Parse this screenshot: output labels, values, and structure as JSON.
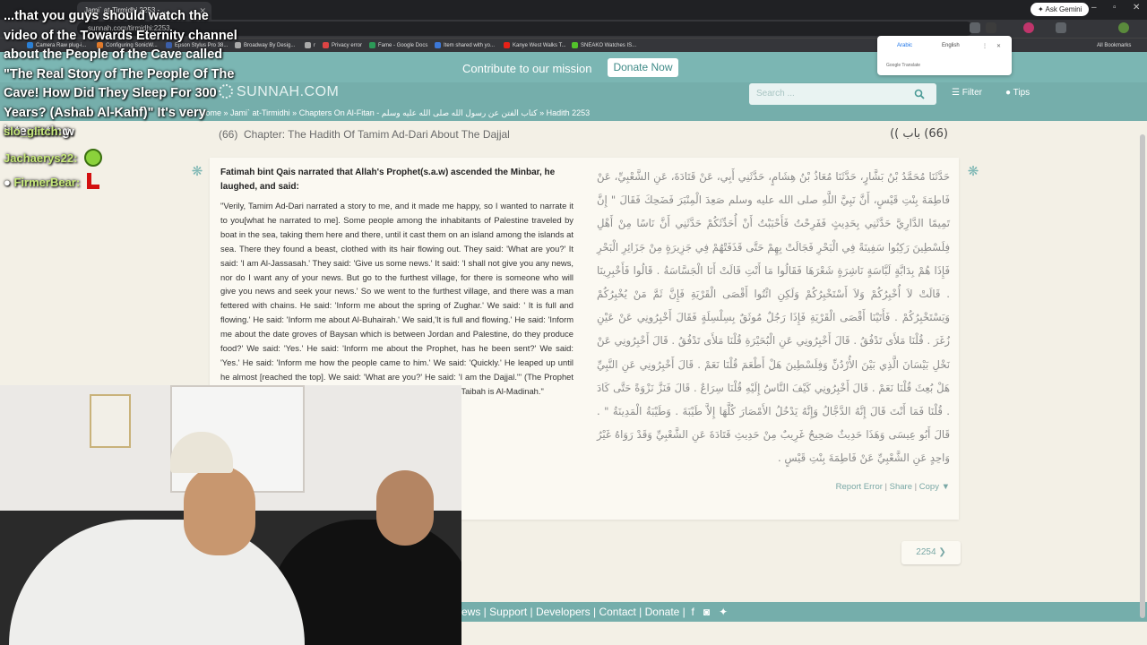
{
  "browser": {
    "tab_title": "Jami` at-Tirmidhi 2253 - ...",
    "omnibox_url": "sunnah.com/tirmidhi:2253",
    "ask_gemini": "✦ Ask Gemini",
    "bookmarks": [
      "Camera Raw plug-i...",
      "Configuring SonicW...",
      "Epson Stylus Pro 38...",
      "Broadway By Desig...",
      "r",
      "Privacy error",
      "Fame - Google Docs",
      "Item shared with yo...",
      "Kanye West Walks T...",
      "SNEAKO Watches IS..."
    ],
    "all_bookmarks": "All Bookmarks"
  },
  "translate_popup": {
    "lang_from": "Arabic",
    "lang_to": "English",
    "footer": "Google Translate"
  },
  "site": {
    "contribute_text": "Contribute to our mission",
    "donate_label": "Donate Now",
    "logo": "SUNNAH.COM",
    "search_placeholder": "Search ...",
    "filter_label": "Filter",
    "tips_label": "Tips",
    "breadcrumb": "Home » Jami` at-Tirmidhi » Chapters On Al-Fitan - كتاب الفتن عن رسول الله صلى الله عليه وسلم » Hadith 2253"
  },
  "chapter": {
    "number": "(66)",
    "title_en": "Chapter: The Hadith Of Tamim Ad-Dari About The Dajjal",
    "title_ar": "(66) باب ))"
  },
  "hadith": {
    "narrator": "Fatimah bint Qais narrated that Allah's Prophet(s.a.w) ascended the Minbar, he laughed, and said:",
    "english": "\"Verily, Tamim Ad-Dari narrated a story to me, and it made me happy, so I wanted to narrate it to you[what he narrated to me]. Some people among the inhabitants of Palestine traveled by boat in the sea, taking them here and there, until it cast them on an island among the islands at sea. There they found a beast, clothed with its hair flowing out. They said: 'What are you?' It said: 'I am Al-Jassasah.' They said: 'Give us some news.' It said: 'I shall not give you any news, nor do I want any of your news. But go to the furthest village, for there is someone who will give you news and seek your news.' So we went to the furthest village, and there was a man fettered with chains. He said: 'Inform me about the spring of Zughar.' We said: ' It is full and flowing.' He said: 'Inform me about Al-Buhairah.' We said,'It is full and flowing.' He said: 'Inform me about the date groves of Baysan which is between Jordan and Palestine, do they produce food?' We said: 'Yes.' He said: 'Inform me about the Prophet, has he been sent?' We said: 'Yes.' He said: 'Inform me how the people came to him.' We said: 'Quickly.' He leaped up until he almost [reached the top]. We said: 'What are you?' He said: 'I am the Dajjal.'\" (The Prophet (s.a.w) said:) \"He will enter all of the cities except Taibah, and At-Taibah is Al-Madinah.\"",
    "arabic": "حَدَّثَنَا مُحَمَّدُ بْنُ بَشَّارٍ، حَدَّثَنَا مُعَاذُ بْنُ هِشَامٍ، حَدَّثَنِي أَبِي، عَنْ قَتَادَةَ، عَنِ الشَّعْبِيِّ، عَنْ فَاطِمَةَ بِنْتِ قَيْسٍ، أَنَّ نَبِيَّ اللَّهِ صلى الله عليه وسلم صَعِدَ الْمِنْبَرَ فَضَحِكَ فَقَالَ ‏\"‏ إِنَّ تَمِيمًا الدَّارِيَّ حَدَّثَنِي بِحَدِيثٍ فَفَرِحْتُ فَأَحْبَبْتُ أَنْ أُحَدِّثَكُمْ حَدَّثَنِي أَنَّ نَاسًا مِنْ أَهْلِ فِلَسْطِينَ رَكِبُوا سَفِينَةً فِي الْبَحْرِ فَجَالَتْ بِهِمْ حَتَّى قَذَفَتْهُمْ فِي جَزِيرَةٍ مِنْ جَزَائِرِ الْبَحْرِ فَإِذَا هُمْ بِدَابَّةٍ لَبَّاسَةٍ نَاشِرَةٍ شَعْرَهَا فَقَالُوا مَا أَنْتِ قَالَتْ أَنَا الْجَسَّاسَةُ ‏.‏ قَالُوا فَأَخْبِرِينَا ‏.‏ قَالَتْ لاَ أُخْبِرُكُمْ وَلاَ أَسْتَخْبِرُكُمْ وَلَكِنِ ائْتُوا أَقْصَى الْقَرْيَةِ فَإِنَّ ثَمَّ مَنْ يُخْبِرُكُمْ وَيَسْتَخْبِرُكُمْ ‏.‏ فَأَتَيْنَا أَقْصَى الْقَرْيَةِ فَإِذَا رَجُلٌ مُوثَقٌ بِسِلْسِلَةٍ فَقَالَ أَخْبِرُونِي عَنْ عَيْنِ زُغَرَ ‏.‏ قُلْنَا مَلأَى تَدْفُقُ ‏.‏ قَالَ أَخْبِرُونِي عَنِ الْبُحَيْرَةِ قُلْنَا مَلأَى تَدْفُقُ ‏.‏ قَالَ أَخْبِرُونِي عَنْ نَخْلِ بَيْسَانَ الَّذِي بَيْنَ الأُرْدُنِّ وَفِلَسْطِينَ هَلْ أَطْعَمَ قُلْنَا نَعَمْ ‏.‏ قَالَ أَخْبِرُونِي عَنِ النَّبِيِّ هَلْ بُعِثَ قُلْنَا نَعَمْ ‏.‏ قَالَ أَخْبِرُونِي كَيْفَ النَّاسُ إِلَيْهِ قُلْنَا سِرَاعٌ ‏.‏ قَالَ فَنَزَّ نَزْوَةً حَتَّى كَادَ ‏.‏ قُلْنَا فَمَا أَنْتَ قَالَ إِنَّهُ الدَّجَّالُ وَإِنَّهُ يَدْخُلُ الأَمْصَارَ كُلَّهَا إِلاَّ طَيْبَةَ ‏.‏ وَطَيْبَةُ الْمَدِينَةُ ‏\"‏ ‏.‏ قَالَ أَبُو عِيسَى وَهَذَا حَدِيثٌ صَحِيحٌ غَرِيبٌ مِنْ حَدِيثِ قَتَادَةَ عَنِ الشَّعْبِيِّ وَقَدْ رَوَاهُ غَيْرُ وَاحِدٍ عَنِ الشَّعْبِيِّ عَنْ فَاطِمَةَ بِنْتِ قَيْسٍ ‏.‏",
    "report_error": "Report Error",
    "share": "Share",
    "copy": "Copy ▼"
  },
  "next_hadith": "2254 ❯",
  "footer": [
    "ews",
    "Support",
    "Developers",
    "Contact",
    "Donate"
  ],
  "stream_overlay": {
    "title": "...that you guys should watch the video of the Towards Eternity channel about the People of the Cave called \"The Real Story of The People Of The Cave! How Did They Sleep For 300 Years? (Ashab Al-Kahf)\" It's very interesting.",
    "chat": [
      {
        "user": "slo_glitch:",
        "message": "w"
      },
      {
        "user": "Jachaerys22:",
        "message": ""
      },
      {
        "user": "FirmerBear:",
        "message": ""
      }
    ]
  },
  "colors": {
    "site_teal": "#7bb6b3",
    "card_bg": "#fbf9f2",
    "link": "#7aa8a6"
  }
}
